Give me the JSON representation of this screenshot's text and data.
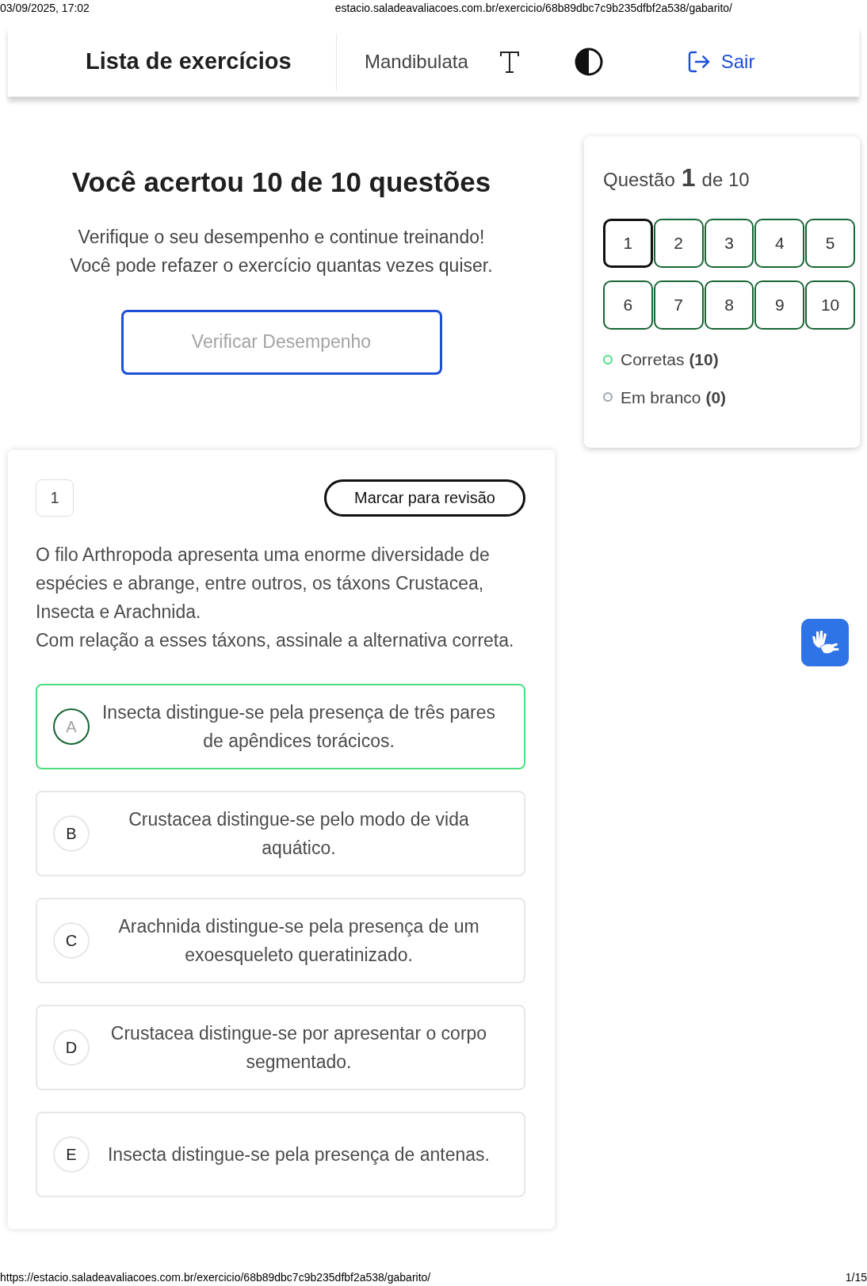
{
  "print_header": {
    "date": "03/09/2025, 17:02",
    "url": "estacio.saladeavaliacoes.com.br/exercicio/68b89dbc7c9b235dfbf2a538/gabarito/"
  },
  "header": {
    "title": "Lista de exercícios",
    "subject": "Mandibulata",
    "logout": "Sair"
  },
  "result": {
    "title": "Você acertou 10 de 10 questões",
    "subtitle_lines": [
      "Verifique o seu desempenho e continue treinando!",
      "Você pode refazer o exercício quantas vezes quiser."
    ],
    "button": "Verificar Desempenho"
  },
  "navigator": {
    "prefix": "Questão",
    "current": "1",
    "suffix": "de 10",
    "questions": [
      {
        "label": "1",
        "selected": true
      },
      {
        "label": "2",
        "selected": false
      },
      {
        "label": "3",
        "selected": false
      },
      {
        "label": "4",
        "selected": false
      },
      {
        "label": "5",
        "selected": false
      },
      {
        "label": "6",
        "selected": false
      },
      {
        "label": "7",
        "selected": false
      },
      {
        "label": "8",
        "selected": false
      },
      {
        "label": "9",
        "selected": false
      },
      {
        "label": "10",
        "selected": false
      }
    ],
    "legend": [
      {
        "label": "Corretas",
        "count": "(10)",
        "color": "#4ade80"
      },
      {
        "label": "Em branco",
        "count": "(0)",
        "color": "#9ca3af"
      }
    ]
  },
  "question": {
    "number": "1",
    "review_button": "Marcar para revisão",
    "statement_lines": [
      "O filo Arthropoda apresenta uma enorme diversidade de espécies e abrange, entre outros, os táxons Crustacea, Insecta e Arachnida.",
      "Com relação a esses táxons, assinale a alternativa correta."
    ],
    "options": [
      {
        "letter": "A",
        "text": "Insecta distingue-se pela presença de três pares de apêndices torácicos.",
        "selected": true
      },
      {
        "letter": "B",
        "text": "Crustacea distingue-se pelo modo de vida aquático.",
        "selected": false
      },
      {
        "letter": "C",
        "text": "Arachnida distingue-se pela presença de um exoesqueleto queratinizado.",
        "selected": false
      },
      {
        "letter": "D",
        "text": "Crustacea distingue-se por apresentar o corpo segmentado.",
        "selected": false
      },
      {
        "letter": "E",
        "text": "Insecta distingue-se pela presença de antenas.",
        "selected": false
      }
    ]
  },
  "print_footer": {
    "url": "https://estacio.saladeavaliacoes.com.br/exercicio/68b89dbc7c9b235dfbf2a538/gabarito/",
    "page": "1/15"
  }
}
